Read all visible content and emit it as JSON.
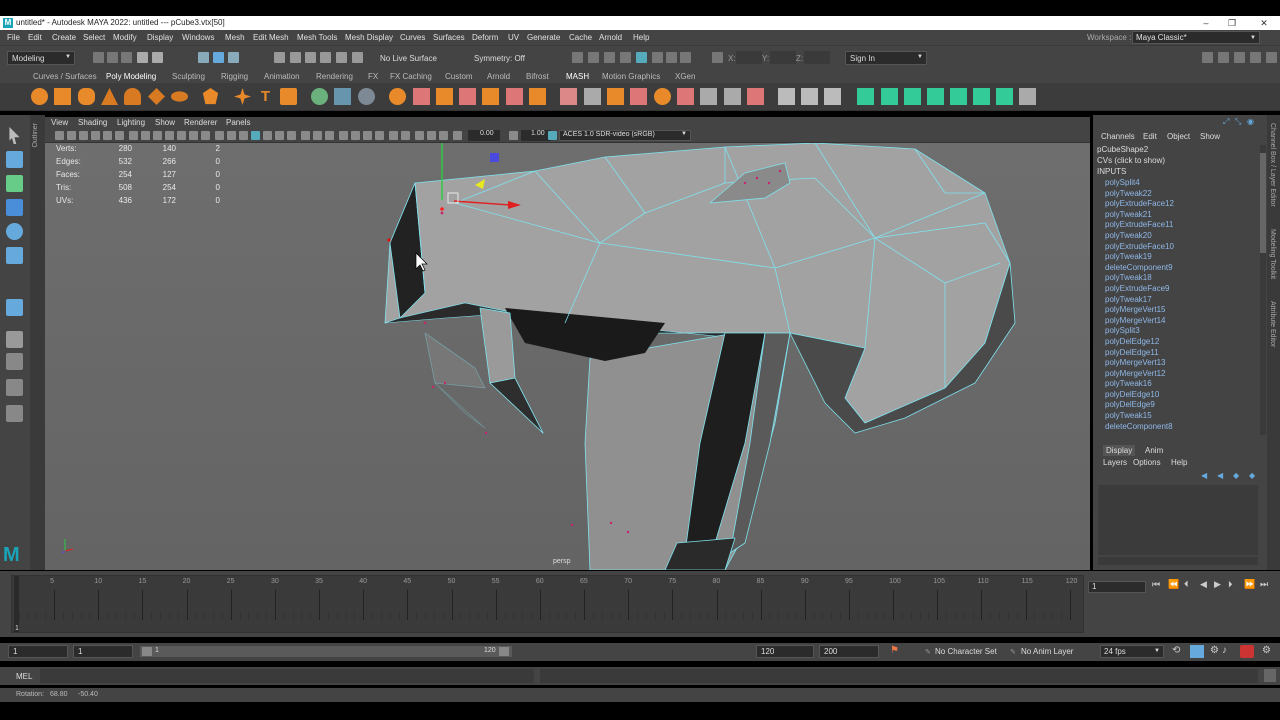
{
  "window": {
    "title": "untitled* - Autodesk MAYA 2022: untitled   ---   pCube3.vtx[50]",
    "logo": "M",
    "minimize": "–",
    "maximize": "❐",
    "close": "✕"
  },
  "menus": [
    "File",
    "Edit",
    "Create",
    "Select",
    "Modify",
    "Display",
    "Windows",
    "Mesh",
    "Edit Mesh",
    "Mesh Tools",
    "Mesh Display",
    "Curves",
    "Surfaces",
    "Deform",
    "UV",
    "Generate",
    "Cache",
    "Arnold",
    "Help"
  ],
  "workspace": {
    "label": "Workspace :",
    "value": "Maya Classic*"
  },
  "status": {
    "menuset": "Modeling",
    "live_surface": "No Live Surface",
    "symmetry": "Symmetry: Off",
    "x": "X:",
    "y": "Y:",
    "z": "Z:",
    "sign_in": "Sign In"
  },
  "shelf_tabs": [
    "Curves / Surfaces",
    "Poly Modeling",
    "Sculpting",
    "Rigging",
    "Animation",
    "Rendering",
    "FX",
    "FX Caching",
    "Custom",
    "Arnold",
    "Bifrost",
    "MASH",
    "Motion Graphics",
    "XGen"
  ],
  "shelf_active": 1,
  "viewport": {
    "menus": [
      "View",
      "Shading",
      "Lighting",
      "Show",
      "Renderer",
      "Panels"
    ],
    "exposure": "0.00",
    "gamma": "1.00",
    "colorspace": "ACES 1.0 SDR-video (sRGB)",
    "camera": "persp",
    "side_label": "Outliner",
    "hud": [
      {
        "label": "Verts:",
        "a": "280",
        "b": "140",
        "c": "2"
      },
      {
        "label": "Edges:",
        "a": "532",
        "b": "266",
        "c": "0"
      },
      {
        "label": "Faces:",
        "a": "254",
        "b": "127",
        "c": "0"
      },
      {
        "label": "Tris:",
        "a": "508",
        "b": "254",
        "c": "0"
      },
      {
        "label": "UVs:",
        "a": "436",
        "b": "172",
        "c": "0"
      }
    ]
  },
  "channel_box": {
    "tabs": [
      "Channels",
      "Edit",
      "Object",
      "Show"
    ],
    "object": "pCubeShape2",
    "cvs": "CVs (click to show)",
    "inputs_label": "INPUTS",
    "history": [
      "polySplit4",
      "polyTweak22",
      "polyExtrudeFace12",
      "polyTweak21",
      "polyExtrudeFace11",
      "polyTweak20",
      "polyExtrudeFace10",
      "polyTweak19",
      "deleteComponent9",
      "polyTweak18",
      "polyExtrudeFace9",
      "polyTweak17",
      "polyMergeVert15",
      "polyMergeVert14",
      "polySplit3",
      "polyDelEdge12",
      "polyDelEdge11",
      "polyMergeVert13",
      "polyMergeVert12",
      "polyTweak16",
      "polyDelEdge10",
      "polyDelEdge9",
      "polyTweak15",
      "deleteComponent8"
    ]
  },
  "layer_editor": {
    "tabs": [
      "Display",
      "Anim"
    ],
    "menus": [
      "Layers",
      "Options",
      "Help"
    ]
  },
  "right_tabs": [
    "Channel Box / Layer Editor",
    "Modeling Toolkit",
    "Attribute Editor"
  ],
  "timeline": {
    "ticks": [
      "5",
      "10",
      "15",
      "20",
      "25",
      "30",
      "35",
      "40",
      "45",
      "50",
      "55",
      "60",
      "65",
      "70",
      "75",
      "80",
      "85",
      "90",
      "95",
      "100",
      "105",
      "110",
      "115",
      "120"
    ],
    "start_marker": "1",
    "current": "1"
  },
  "range": {
    "start": "1",
    "inner_start": "1",
    "slider_start": "1",
    "slider_end": "120",
    "end": "120",
    "max": "200",
    "char_set": "No Character Set",
    "anim_layer": "No Anim Layer",
    "fps": "24 fps"
  },
  "mel": {
    "label": "MEL"
  },
  "help": {
    "text": "Rotation:",
    "v1": "68.80",
    "v2": "-50.40"
  }
}
